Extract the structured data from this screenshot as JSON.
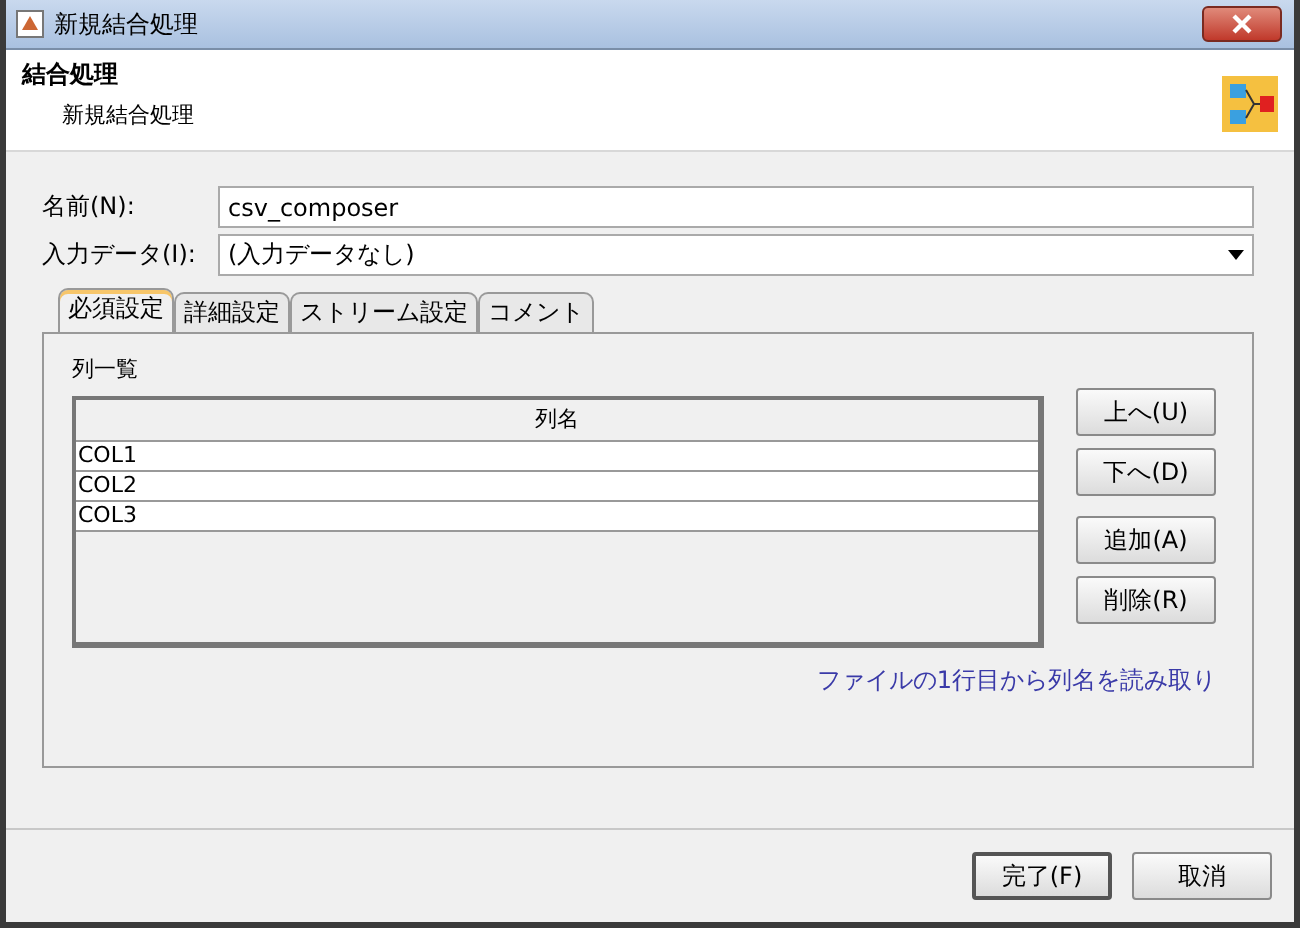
{
  "window": {
    "title": "新規結合処理"
  },
  "header": {
    "title": "結合処理",
    "subtitle": "新規結合処理"
  },
  "fields": [
    {
      "kind": "text",
      "label": "名前(N):",
      "value": "csv_composer"
    },
    {
      "kind": "dropdown",
      "label": "入力データ(I):",
      "value": "(入力データなし)"
    }
  ],
  "tabs": [
    {
      "label": "必須設定",
      "selected": true
    },
    {
      "label": "詳細設定",
      "selected": false
    },
    {
      "label": "ストリーム設定",
      "selected": false
    },
    {
      "label": "コメント",
      "selected": false
    }
  ],
  "column_list": {
    "title": "列一覧",
    "header": "列名",
    "rows": [
      "COL1",
      "COL2",
      "COL3"
    ]
  },
  "side_buttons": [
    "上へ(U)",
    "下へ(D)",
    "追加(A)",
    "削除(R)"
  ],
  "link": "ファイルの1行目から列名を読み取り",
  "buttons": [
    "完了(F)",
    "取消"
  ]
}
